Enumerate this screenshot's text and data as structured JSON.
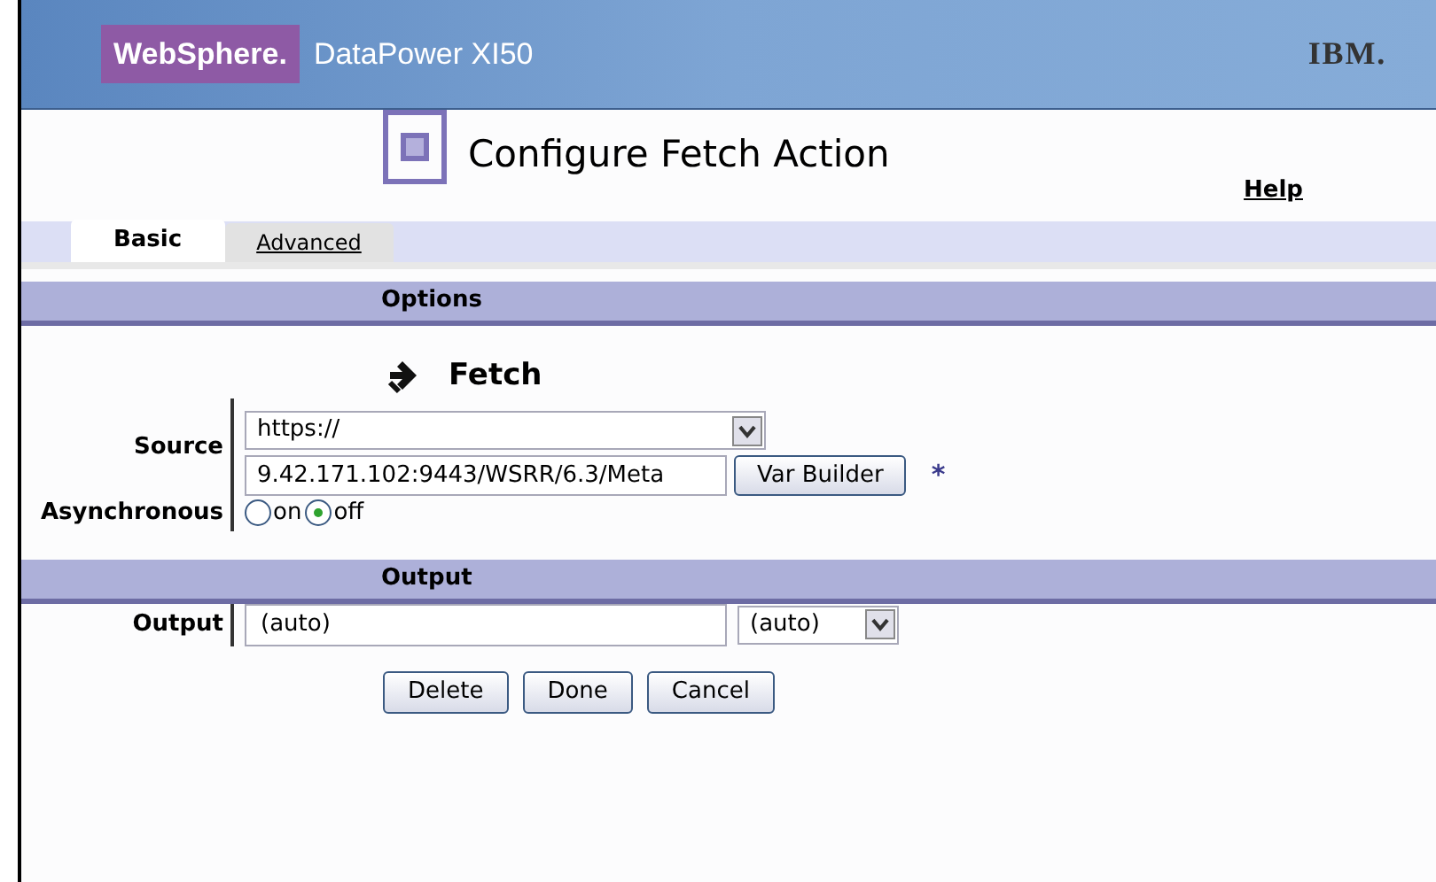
{
  "header": {
    "brand": "WebSphere.",
    "product": "DataPower XI50",
    "vendor": "IBM."
  },
  "title": "Configure Fetch Action",
  "help": "Help",
  "tabs": [
    {
      "label": "Basic",
      "selected": true
    },
    {
      "label": "Advanced",
      "selected": false
    }
  ],
  "options": {
    "heading": "Options",
    "action": "Fetch",
    "source": {
      "label": "Source",
      "protocol": "https://",
      "url": "9.42.171.102:9443/WSRR/6.3/Meta",
      "button": "Var Builder",
      "required": "*"
    },
    "asynchronous": {
      "label": "Asynchronous",
      "choices": [
        {
          "label": "on",
          "selected": false
        },
        {
          "label": "off",
          "selected": true
        }
      ]
    }
  },
  "output": {
    "heading": "Output",
    "label": "Output",
    "value": "(auto)",
    "type": "(auto)"
  },
  "buttons": [
    "Delete",
    "Done",
    "Cancel"
  ]
}
